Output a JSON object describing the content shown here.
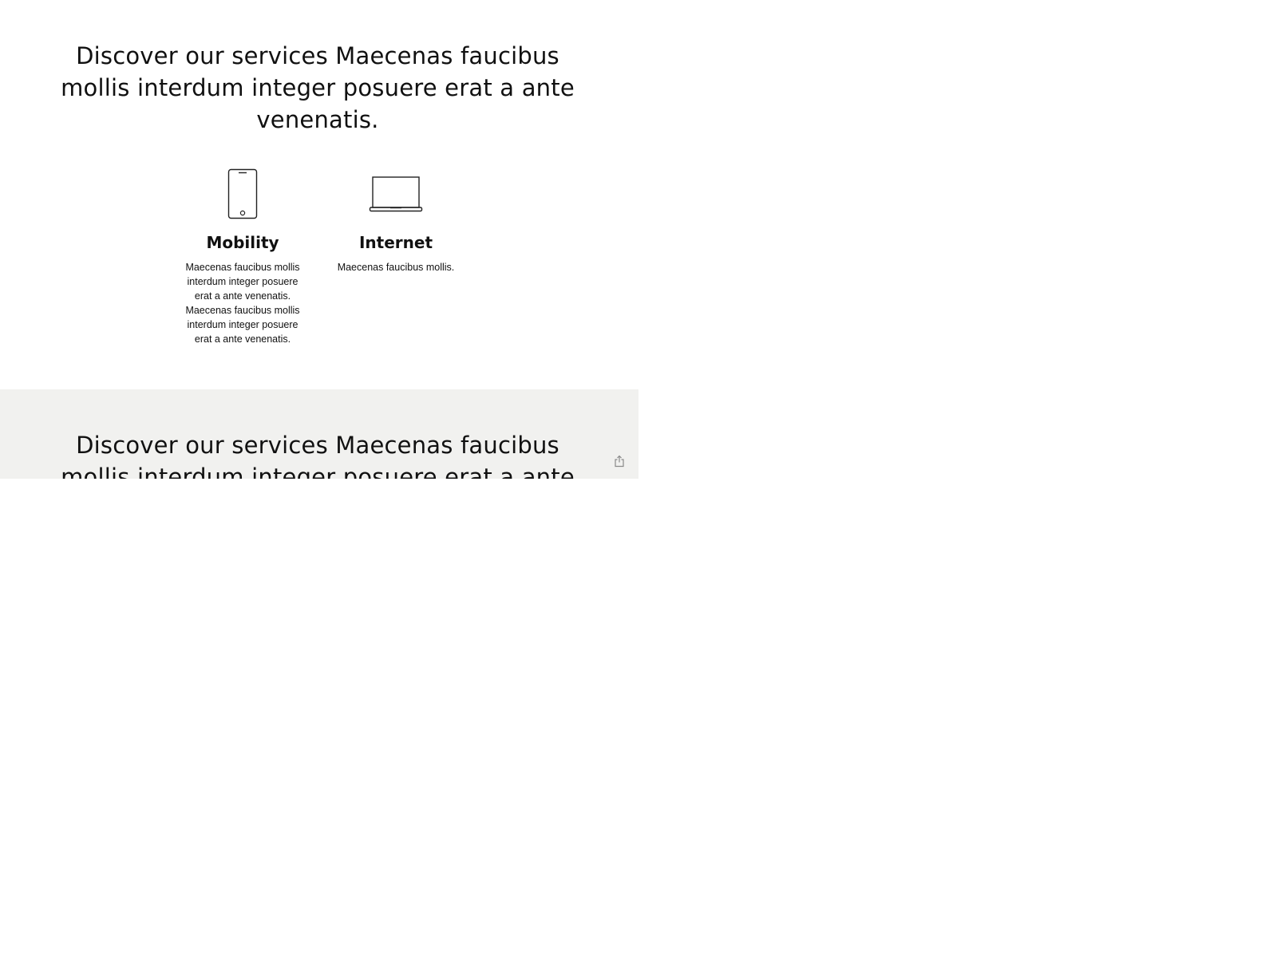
{
  "sections": [
    {
      "headline": "Discover our services Maecenas faucibus mollis interdum integer posuere erat a ante venenatis."
    },
    {
      "headline": "Discover our services Maecenas faucibus mollis interdum integer posuere erat a ante venenatis."
    }
  ],
  "services": [
    {
      "icon": "smartphone-icon",
      "title": "Mobility",
      "text": "Maecenas faucibus mollis interdum integer posuere erat a ante venenatis. Maecenas faucibus mollis interdum integer posuere erat a ante venenatis."
    },
    {
      "icon": "laptop-icon",
      "title": "Internet",
      "text": "Maecenas faucibus mollis."
    }
  ],
  "share_icon": "share-icon",
  "colors": {
    "text": "#111111",
    "grey_section_background": "#f1f1ef",
    "icon_stroke": "#222222",
    "share_icon": "#8a8a8a"
  }
}
